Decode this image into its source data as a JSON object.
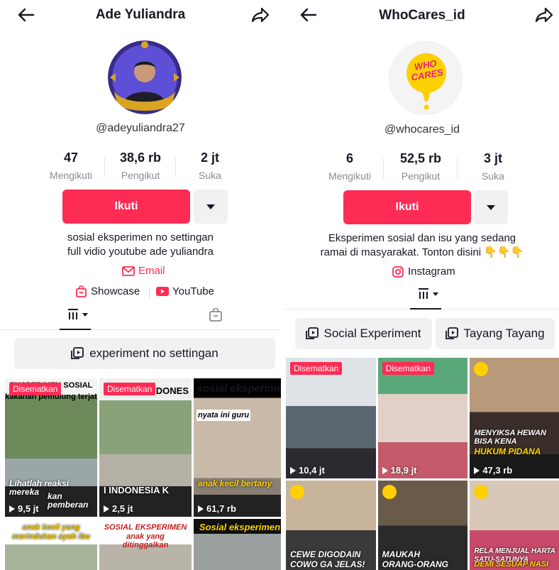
{
  "left": {
    "title": "Ade Yuliandra",
    "handle": "@adeyuliandra27",
    "stats": [
      {
        "num": "47",
        "label": "Mengikuti"
      },
      {
        "num": "38,6 rb",
        "label": "Pengikut"
      },
      {
        "num": "2 jt",
        "label": "Suka"
      }
    ],
    "follow_label": "Ikuti",
    "bio": [
      "sosial eksperimen no settingan",
      "full vidio youtube ade yuliandra"
    ],
    "email_label": "Email",
    "showcase_label": "Showcase",
    "youtube_label": "YouTube",
    "playlist_label": "experiment no settingan",
    "videos": [
      {
        "pinned": "Disematkan",
        "views": "9,5 jt",
        "top": "EKSPERIMEN SOSIAL",
        "top2": "kakanan pemulung terjat",
        "bottom": "Lihatlah reaksi mereka",
        "bottom2": "kan pemberan"
      },
      {
        "pinned": "Disematkan",
        "views": "2,5 jt",
        "top": "INDONES",
        "bottom": "I INDONESIA K"
      },
      {
        "pinned": "",
        "views": "61,7 rb",
        "top": "sosial eksperime",
        "mid": "nyata ini guru",
        "bottom": "anak kecil bertany"
      },
      {
        "pinned": "",
        "views": "",
        "top": "anak kecil yang",
        "top2": "merindukan ayah ibu"
      },
      {
        "pinned": "",
        "views": "",
        "top": "SOSIAL EKSPERIMEN",
        "top2": "anak yang ditinggalkan"
      },
      {
        "pinned": "",
        "views": "",
        "top": "Sosial eksperimen"
      }
    ]
  },
  "right": {
    "title": "WhoCares_id",
    "handle": "@whocares_id",
    "logo_text": "WHO CARES",
    "stats": [
      {
        "num": "6",
        "label": "Mengikuti"
      },
      {
        "num": "52,5 rb",
        "label": "Pengikut"
      },
      {
        "num": "3 jt",
        "label": "Suka"
      }
    ],
    "follow_label": "Ikuti",
    "bio": [
      "Eksperimen sosial dan isu yang sedang",
      "ramai di masyarakat. Tonton disini 👇👇👇"
    ],
    "instagram_label": "Instagram",
    "playlists": [
      "Social Experiment",
      "Tayang Tayang"
    ],
    "videos": [
      {
        "pinned": "Disematkan",
        "views": "10,4 jt",
        "caption": ""
      },
      {
        "pinned": "Disematkan",
        "views": "18,9 jt",
        "caption": ""
      },
      {
        "pinned": "",
        "views": "47,3 rb",
        "caption": "MENYIKSA HEWAN BISA KENA",
        "caption2": "HUKUM PIDANA"
      },
      {
        "pinned": "",
        "views": "",
        "caption": "CEWE DIGODAIN",
        "caption2": "COWO GA JELAS!"
      },
      {
        "pinned": "",
        "views": "",
        "caption": "MAUKAH",
        "caption2": "ORANG-ORANG"
      },
      {
        "pinned": "",
        "views": "",
        "caption": "RELA MENJUAL HARTA SATU-SATUNYA",
        "caption2": "DEMI SESUAP NASI"
      }
    ]
  },
  "colors": {
    "accent": "#fe2c55",
    "text": "#161823",
    "muted": "#8a8b91"
  }
}
